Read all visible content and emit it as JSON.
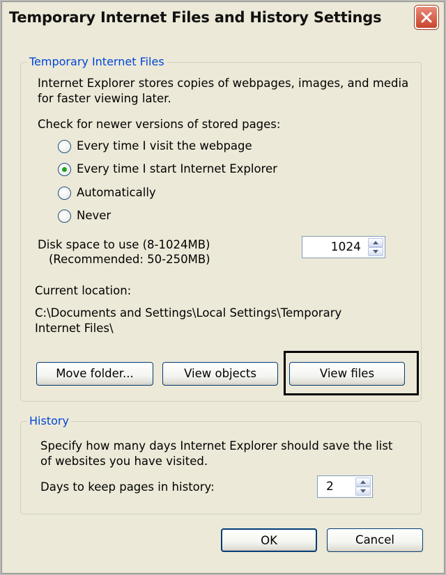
{
  "window": {
    "title": "Temporary Internet Files and History Settings",
    "close_icon": "close-x-icon"
  },
  "temp_files": {
    "legend": "Temporary Internet Files",
    "description_line1": "Internet Explorer stores copies of webpages, images, and media",
    "description_line2": "for faster viewing later.",
    "check_label": "Check for newer versions of stored pages:",
    "options": [
      {
        "label": "Every time I visit the webpage",
        "checked": false
      },
      {
        "label": "Every time I start Internet Explorer",
        "checked": true
      },
      {
        "label": "Automatically",
        "checked": false
      },
      {
        "label": "Never",
        "checked": false
      }
    ],
    "disk_label_line1": "Disk space to use (8-1024MB)",
    "disk_label_line2": "(Recommended: 50-250MB)",
    "disk_value": "1024",
    "location_label": "Current location:",
    "location_line1": "C:\\Documents and Settings\\Local Settings\\Temporary",
    "location_line2": "Internet Files\\",
    "buttons": {
      "move_folder": "Move folder...",
      "view_objects": "View objects",
      "view_files": "View files"
    }
  },
  "history": {
    "legend": "History",
    "description_line1": "Specify how many days Internet Explorer should save the list",
    "description_line2": "of websites you have visited.",
    "days_label": "Days to keep pages in history:",
    "days_value": "2"
  },
  "footer": {
    "ok": "OK",
    "cancel": "Cancel"
  },
  "colors": {
    "dialog_bg": "#ece9d8",
    "legend_blue": "#0046d5",
    "close_red": "#c8452c",
    "radio_green": "#21a121"
  }
}
